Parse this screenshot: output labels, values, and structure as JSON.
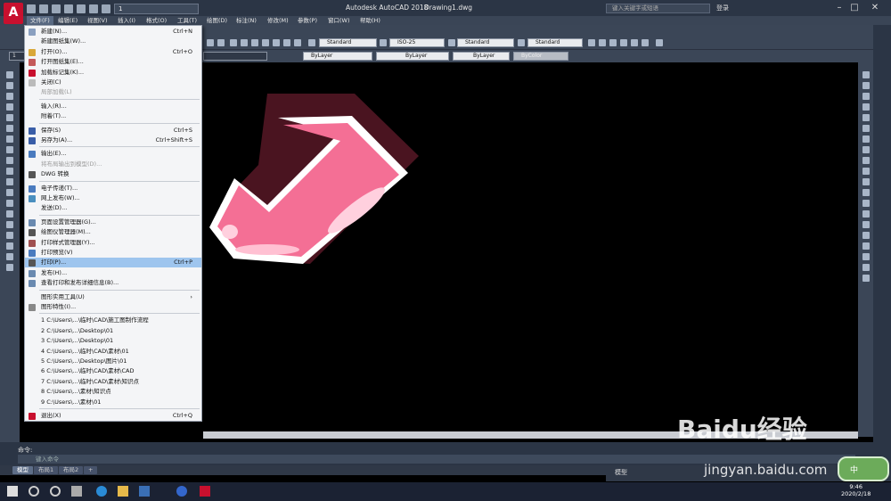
{
  "app": {
    "title": "Autodesk AutoCAD 2018",
    "document": "Drawing1.dwg",
    "search_placeholder": "键入关键字或短语",
    "login_label": "登录",
    "workspace_combo": "1"
  },
  "menubar": [
    {
      "label": "文件(F)",
      "active": true
    },
    {
      "label": "编辑(E)"
    },
    {
      "label": "视图(V)"
    },
    {
      "label": "插入(I)"
    },
    {
      "label": "格式(O)"
    },
    {
      "label": "工具(T)"
    },
    {
      "label": "绘图(D)"
    },
    {
      "label": "标注(N)"
    },
    {
      "label": "修改(M)"
    },
    {
      "label": "参数(P)"
    },
    {
      "label": "窗口(W)"
    },
    {
      "label": "帮助(H)"
    }
  ],
  "toolbar": {
    "text_style": "Standard",
    "dim_style": "ISO-25",
    "table_style": "Standard",
    "mleader_style": "Standard",
    "layer_value": "1",
    "color": "ByLayer",
    "linetype": "ByLayer",
    "lineweight": "ByLayer",
    "plotstyle": "ByColor"
  },
  "file_menu": [
    {
      "label": "新建(N)...",
      "shortcut": "Ctrl+N",
      "icon_color": "#8aa0c0"
    },
    {
      "label": "新建图纸集(W)...",
      "shortcut": "",
      "icon_color": ""
    },
    {
      "label": "打开(O)...",
      "shortcut": "Ctrl+O",
      "icon_color": "#d9a83a"
    },
    {
      "label": "打开图纸集(E)...",
      "shortcut": "",
      "icon_color": "#c45a5a"
    },
    {
      "label": "加载标记集(K)...",
      "shortcut": "",
      "icon_color": "#c8102e"
    },
    {
      "label": "关闭(C)",
      "shortcut": "",
      "icon_color": "#bbbbbb"
    },
    {
      "label": "局部加载(L)",
      "shortcut": "",
      "icon_color": "",
      "disabled": true
    },
    {
      "sep": true
    },
    {
      "label": "输入(R)...",
      "shortcut": "",
      "icon_color": ""
    },
    {
      "label": "附着(T)...",
      "shortcut": "",
      "icon_color": ""
    },
    {
      "sep": true
    },
    {
      "label": "保存(S)",
      "shortcut": "Ctrl+S",
      "icon_color": "#3a5ea8"
    },
    {
      "label": "另存为(A)...",
      "shortcut": "Ctrl+Shift+S",
      "icon_color": "#3a5ea8"
    },
    {
      "sep": true
    },
    {
      "label": "输出(E)...",
      "shortcut": "",
      "icon_color": "#4a7bbf"
    },
    {
      "label": "将布局输出到模型(D)...",
      "shortcut": "",
      "icon_color": "",
      "disabled": true
    },
    {
      "label": "DWG 转换",
      "shortcut": "",
      "icon_color": "#555555"
    },
    {
      "sep": true
    },
    {
      "label": "电子传递(T)...",
      "shortcut": "",
      "icon_color": "#4a7bbf"
    },
    {
      "label": "网上发布(W)...",
      "shortcut": "",
      "icon_color": "#4a8fbf"
    },
    {
      "label": "发送(D)...",
      "shortcut": "",
      "icon_color": ""
    },
    {
      "sep": true
    },
    {
      "label": "页面设置管理器(G)...",
      "shortcut": "",
      "icon_color": "#6a8ab0"
    },
    {
      "label": "绘图仪管理器(M)...",
      "shortcut": "",
      "icon_color": "#555555"
    },
    {
      "label": "打印样式管理器(Y)...",
      "shortcut": "",
      "icon_color": "#a05050"
    },
    {
      "label": "打印预览(V)",
      "shortcut": "",
      "icon_color": "#4a7bbf"
    },
    {
      "label": "打印(P)...",
      "shortcut": "Ctrl+P",
      "icon_color": "#555555",
      "highlight": true
    },
    {
      "label": "发布(H)...",
      "shortcut": "",
      "icon_color": "#6a8ab0"
    },
    {
      "label": "查看打印和发布详细信息(B)...",
      "shortcut": "",
      "icon_color": "#6a8ab0"
    },
    {
      "sep": true
    },
    {
      "label": "图形实用工具(U)",
      "shortcut": "›",
      "icon_color": ""
    },
    {
      "label": "图形特性(I)...",
      "shortcut": "",
      "icon_color": "#888888"
    },
    {
      "sep": true
    },
    {
      "label": "1 C:\\Users\\...\\临时\\CAD\\施工图制作流程",
      "shortcut": "",
      "icon_color": ""
    },
    {
      "label": "2 C:\\Users\\...\\Desktop\\01",
      "shortcut": "",
      "icon_color": ""
    },
    {
      "label": "3 C:\\Users\\...\\Desktop\\01",
      "shortcut": "",
      "icon_color": ""
    },
    {
      "label": "4 C:\\Users\\...\\临时\\CAD\\素材\\01",
      "shortcut": "",
      "icon_color": ""
    },
    {
      "label": "5 C:\\Users\\...\\Desktop\\图片\\01",
      "shortcut": "",
      "icon_color": ""
    },
    {
      "label": "6 C:\\Users\\...\\临时\\CAD\\素材\\CAD",
      "shortcut": "",
      "icon_color": ""
    },
    {
      "label": "7 C:\\Users\\...\\临时\\CAD\\素材\\知识点",
      "shortcut": "",
      "icon_color": ""
    },
    {
      "label": "8 C:\\Users\\...\\素材\\知识点",
      "shortcut": "",
      "icon_color": ""
    },
    {
      "label": "9 C:\\Users\\...\\素材\\01",
      "shortcut": "",
      "icon_color": ""
    },
    {
      "sep": true
    },
    {
      "label": "退出(X)",
      "shortcut": "Ctrl+Q",
      "icon_color": "#c8102e"
    }
  ],
  "command": {
    "label": "命令:",
    "placeholder": "键入命令"
  },
  "layout_tabs": [
    "模型",
    "布局1",
    "布局2",
    "+"
  ],
  "status": {
    "model": "模型"
  },
  "clock": {
    "time": "9:46",
    "date": "2020/2/18"
  },
  "ime": {
    "text": "中"
  },
  "watermark": {
    "brand": "Baidu经验",
    "url": "jingyan.baidu.com"
  }
}
